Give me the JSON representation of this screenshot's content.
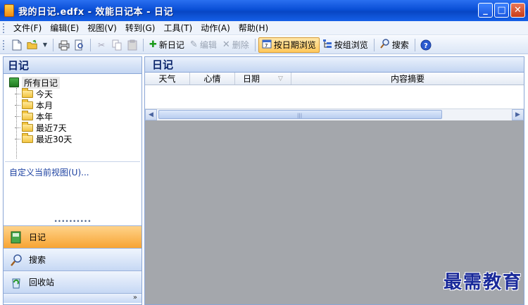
{
  "window": {
    "title": "我的日记.edfx - 效能日记本 - 日记",
    "controls": [
      "_",
      "□",
      "✕"
    ]
  },
  "menu": {
    "items": [
      "文件(F)",
      "编辑(E)",
      "视图(V)",
      "转到(G)",
      "工具(T)",
      "动作(A)",
      "帮助(H)"
    ]
  },
  "toolbar": {
    "new_diary": "新日记",
    "edit": "编辑",
    "delete": "删除",
    "browse_by_date": "按日期浏览",
    "browse_by_group": "按组浏览",
    "search": "搜索"
  },
  "left_pane": {
    "title": "日记",
    "tree_root": "所有日记",
    "tree_children": [
      "今天",
      "本月",
      "本年",
      "最近7天",
      "最近30天"
    ],
    "custom_view": "自定义当前视图(U)...",
    "nav": [
      {
        "label": "日记",
        "icon": "diary-book-icon",
        "active": true
      },
      {
        "label": "搜索",
        "icon": "search-icon",
        "active": false
      },
      {
        "label": "回收站",
        "icon": "recycle-bin-icon",
        "active": false
      }
    ],
    "footer_glyph": "»"
  },
  "right_pane": {
    "title": "日记",
    "columns": [
      "天气",
      "心情",
      "日期",
      "内容摘要"
    ],
    "sort_glyph": "▽"
  },
  "watermark": "最需教育"
}
